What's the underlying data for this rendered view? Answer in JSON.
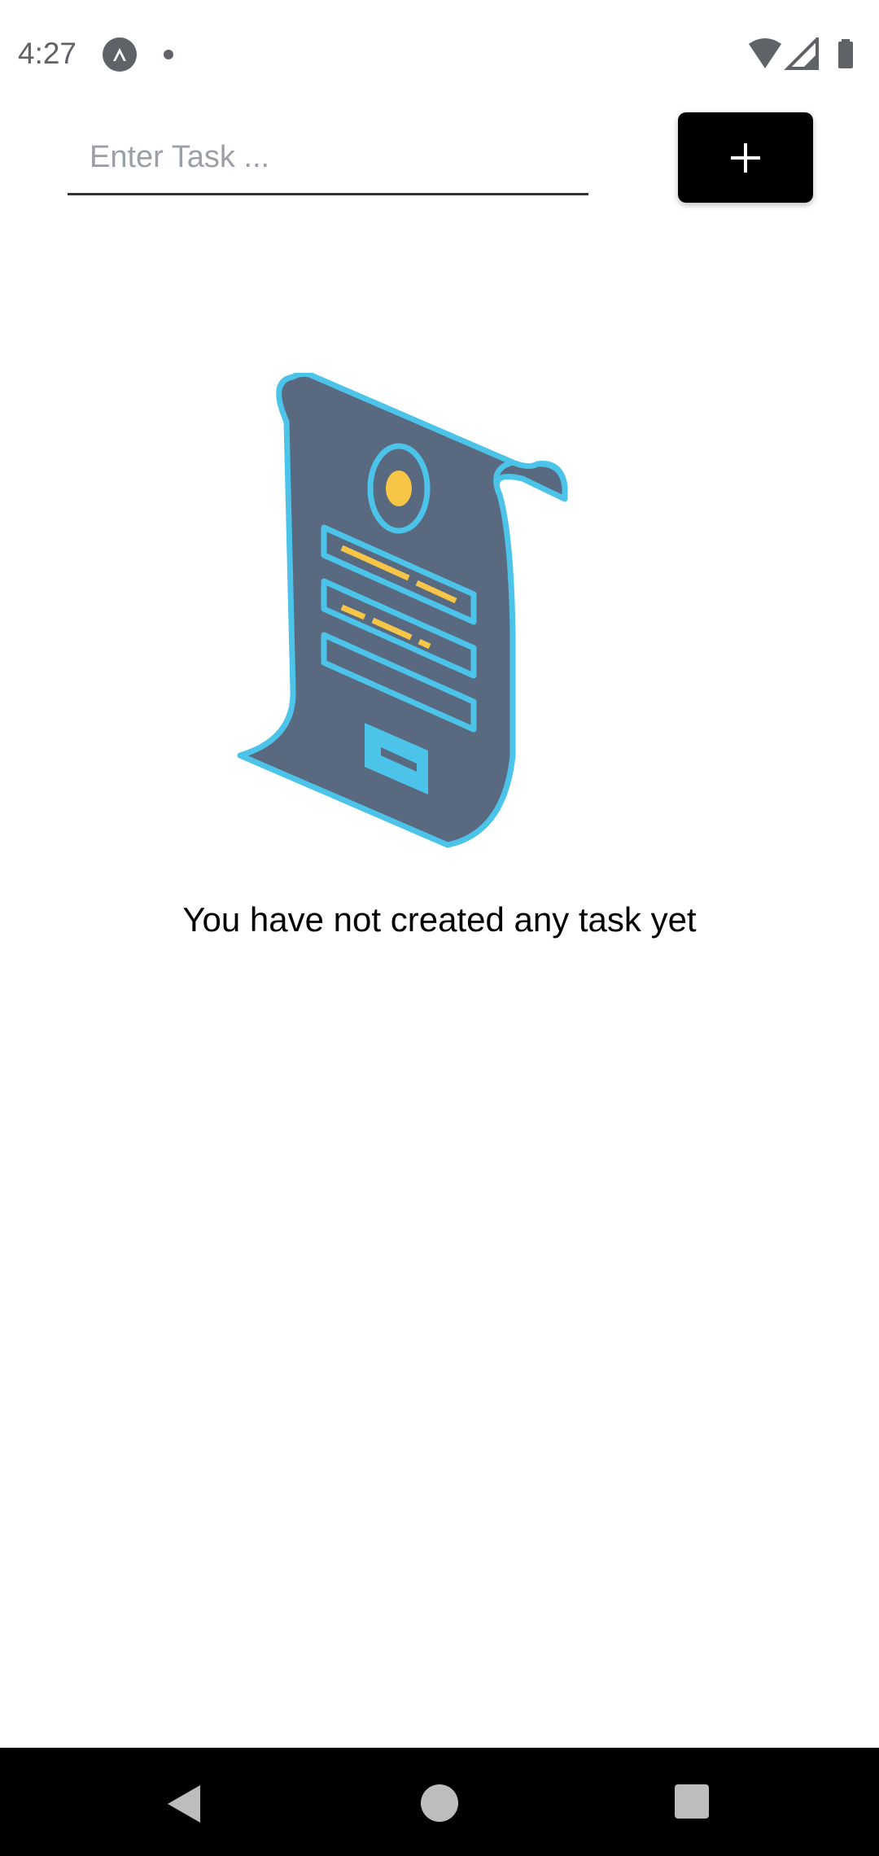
{
  "status_bar": {
    "time": "4:27",
    "app_icon": "expo-app-icon",
    "notification_icon": "dot-icon",
    "wifi_icon": "wifi-icon",
    "signal_icon": "cell-signal-icon",
    "battery_icon": "battery-icon"
  },
  "task_form": {
    "input_value": "",
    "input_placeholder": "Enter Task ...",
    "add_button_icon": "plus-icon"
  },
  "empty_state": {
    "illustration": "scroll-document-icon",
    "message": "You have not created any task yet"
  },
  "colors": {
    "background": "#ffffff",
    "add_button": "#000000",
    "scroll_fill": "#586980",
    "scroll_outline": "#4cc3e8",
    "accent_yellow": "#f7c646",
    "nav_bar": "#000000"
  },
  "nav_bar": {
    "back_icon": "back-triangle-icon",
    "home_icon": "home-circle-icon",
    "recents_icon": "recents-square-icon"
  }
}
